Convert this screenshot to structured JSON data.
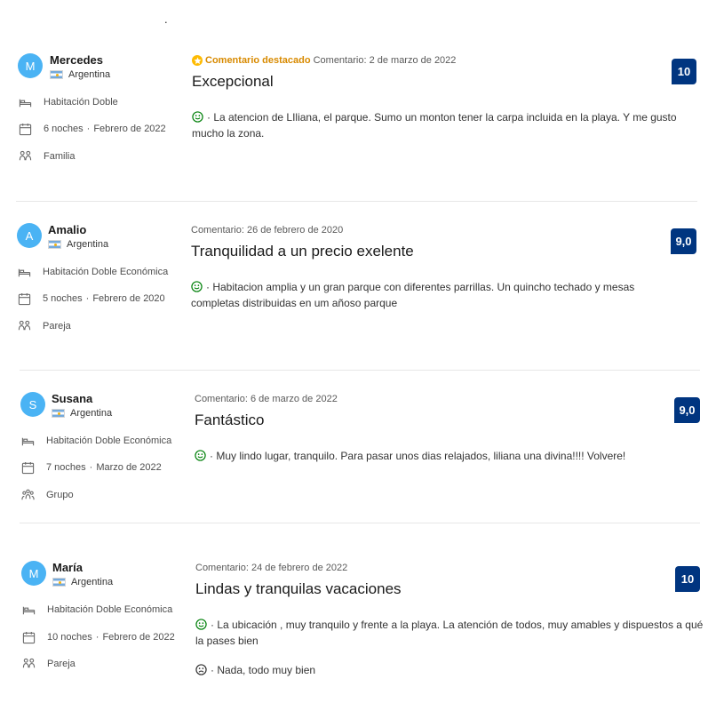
{
  "page": {
    "stray_dot": "."
  },
  "reviews": [
    {
      "initial": "M",
      "name": "Mercedes",
      "country": "Argentina",
      "room": "Habitación Doble",
      "nights": "6 noches",
      "stay_month": "Febrero de 2022",
      "traveler_type": "Familia",
      "featured_label": "Comentario destacado",
      "date": "Comentario: 2 de marzo de 2022",
      "title": "Excepcional",
      "positive": "· La atencion de LIliana, el parque. Sumo un monton tener la carpa incluida en la playa. Y me gusto mucho la zona.",
      "negative": "",
      "score": "10"
    },
    {
      "initial": "A",
      "name": "Amalio",
      "country": "Argentina",
      "room": "Habitación Doble Económica",
      "nights": "5 noches",
      "stay_month": "Febrero de 2020",
      "traveler_type": "Pareja",
      "featured_label": "",
      "date": "Comentario: 26 de febrero de 2020",
      "title": "Tranquilidad a un precio exelente",
      "positive": "· Habitacion amplia y un gran parque con diferentes parrillas. Un quincho techado y mesas completas distribuidas en um añoso parque",
      "negative": "",
      "score": "9,0"
    },
    {
      "initial": "S",
      "name": "Susana",
      "country": "Argentina",
      "room": "Habitación Doble Económica",
      "nights": "7 noches",
      "stay_month": "Marzo de 2022",
      "traveler_type": "Grupo",
      "featured_label": "",
      "date": "Comentario: 6 de marzo de 2022",
      "title": "Fantástico",
      "positive": "· Muy lindo lugar, tranquilo. Para pasar unos dias relajados, liliana una divina!!!! Volvere!",
      "negative": "",
      "score": "9,0"
    },
    {
      "initial": "M",
      "name": "María",
      "country": "Argentina",
      "room": "Habitación Doble Económica",
      "nights": "10 noches",
      "stay_month": "Febrero de 2022",
      "traveler_type": "Pareja",
      "featured_label": "",
      "date": "Comentario: 24 de febrero de 2022",
      "title": "Lindas y tranquilas vacaciones",
      "positive": "· La ubicación , muy tranquilo y frente a la playa. La atención de todos, muy amables y dispuestos a qué la pases bien",
      "negative": "· Nada, todo muy bien",
      "score": "10"
    }
  ],
  "colors": {
    "score_bg": "#003580",
    "avatar_bg": "#4ab3f4",
    "featured": "#d88a00",
    "positive_face": "#008009",
    "negative_face": "#333333"
  },
  "icons": {
    "room": "bed-icon",
    "nights": "calendar-icon",
    "traveler": "people-icon",
    "positive": "smile-icon",
    "negative": "frown-icon",
    "featured": "star-icon"
  }
}
